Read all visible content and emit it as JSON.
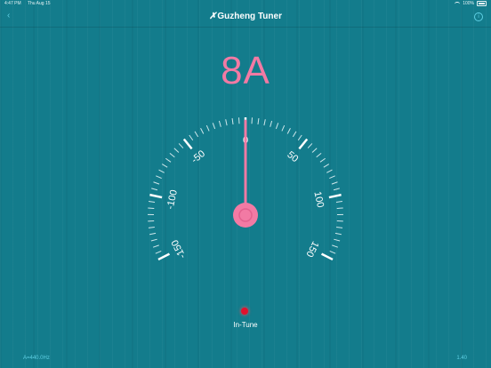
{
  "status_bar": {
    "time": "4:47 PM",
    "date": "Thu Aug 15",
    "battery": "100%"
  },
  "nav": {
    "back_icon": "chevron-left-icon",
    "logo_mark": "✗",
    "title": "Guzheng Tuner",
    "info_icon": "info-icon"
  },
  "note": "8A",
  "gauge": {
    "reading_cents": 0,
    "scale_min": -150,
    "scale_max": 150,
    "major_step": 50,
    "labels": [
      "-150",
      "-100",
      "-50",
      "0",
      "50",
      "100",
      "150"
    ],
    "needle_color": "#f27aa4"
  },
  "status": {
    "label": "In-Tune",
    "indicator_color": "#e0122d"
  },
  "footer": {
    "left": "A=440.0Hz",
    "right": "1.40"
  }
}
